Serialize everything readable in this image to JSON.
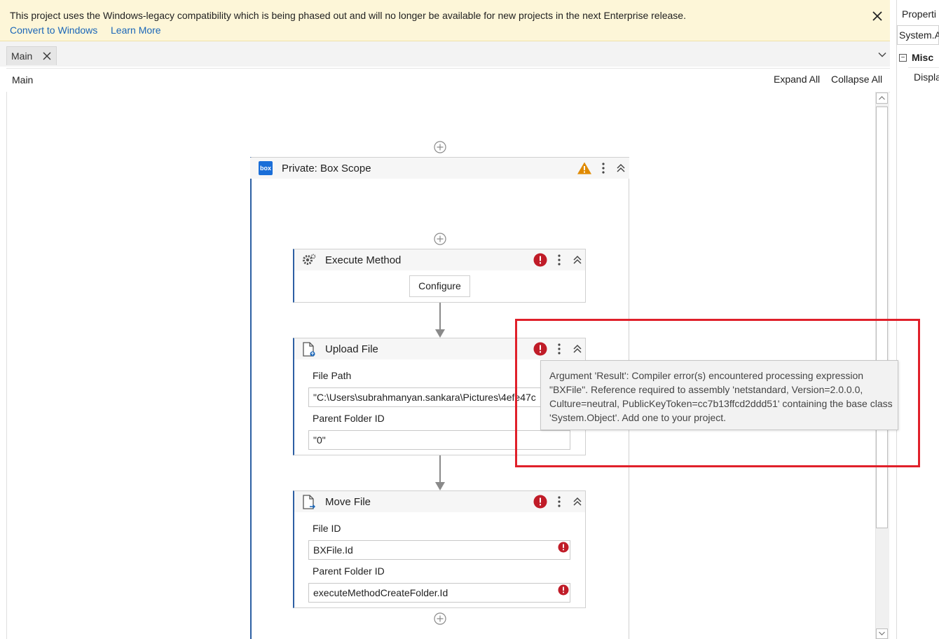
{
  "banner": {
    "message": "This project uses the Windows-legacy compatibility which is being phased out and will no longer be available for new projects in the next Enterprise release.",
    "convert_link": "Convert to Windows",
    "learn_link": "Learn More"
  },
  "tabs": [
    {
      "label": "Main"
    }
  ],
  "designer": {
    "breadcrumb": "Main",
    "expand_all": "Expand All",
    "collapse_all": "Collapse All"
  },
  "properties": {
    "title": "Properti",
    "type": "System.A",
    "category": "Misc",
    "row": "Displa"
  },
  "scope": {
    "title": "Private: Box Scope",
    "logo_text": "box"
  },
  "execute_method": {
    "title": "Execute Method",
    "configure": "Configure"
  },
  "upload_file": {
    "title": "Upload File",
    "file_path_label": "File Path",
    "file_path_value": "\"C:\\Users\\subrahmanyan.sankara\\Pictures\\4efe47c",
    "parent_folder_label": "Parent Folder ID",
    "parent_folder_value": "\"0\""
  },
  "move_file": {
    "title": "Move File",
    "file_id_label": "File ID",
    "file_id_value": "BXFile.Id",
    "parent_folder_label": "Parent Folder ID",
    "parent_folder_value": "executeMethodCreateFolder.Id"
  },
  "tooltip": {
    "text": "Argument 'Result': Compiler error(s) encountered processing expression \"BXFile\". Reference required to assembly 'netstandard, Version=2.0.0.0, Culture=neutral, PublicKeyToken=cc7b13ffcd2ddd51' containing the base class 'System.Object'. Add one to your project."
  },
  "colors": {
    "banner_bg": "#fdf6d8",
    "link": "#1a66b8",
    "accent": "#2d5fa3",
    "error": "#c01c28",
    "warning": "#e08a00",
    "highlight": "#e0202a"
  },
  "icons": {
    "banner_close": "close-icon",
    "tab_close": "close-icon",
    "overflow": "chevron-down-icon",
    "add": "plus-circle-icon",
    "warning": "warning-triangle-icon",
    "error": "error-circle-icon",
    "more": "more-vertical-icon",
    "collapse": "double-chevron-up-icon",
    "execute_method": "gear-icon",
    "upload_file": "file-upload-icon",
    "move_file": "file-move-icon"
  }
}
